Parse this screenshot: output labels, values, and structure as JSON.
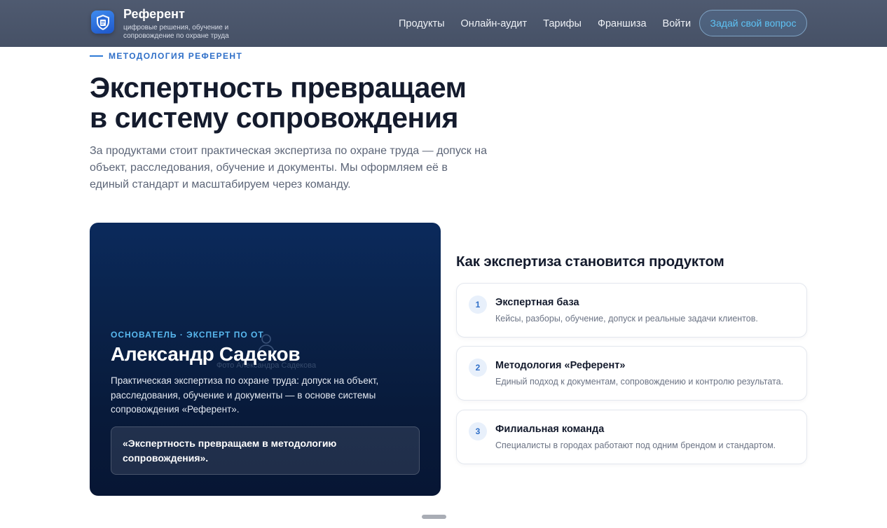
{
  "header": {
    "brand_name": "Референт",
    "brand_tagline": "цифровые решения, обучение и сопровождение по охране труда",
    "nav": [
      {
        "label": "Продукты"
      },
      {
        "label": "Онлайн-аудит"
      },
      {
        "label": "Тарифы"
      },
      {
        "label": "Франшиза"
      },
      {
        "label": "Войти"
      }
    ],
    "cta_label": "Задай свой вопрос",
    "logo_icon": "shield-document-icon"
  },
  "hero": {
    "kicker": "МЕТОДОЛОГИЯ РЕФЕРЕНТ",
    "title_line1": "Экспертность превращаем",
    "title_line2": "в систему сопровождения",
    "lead": "За продуктами стоит практическая экспертиза по охране труда — допуск на объект, расследования, обучение и документы. Мы оформляем её в единый стандарт и масштабируем через команду."
  },
  "founder": {
    "photo_placeholder": "Фото Александра Садекова",
    "role": "ОСНОВАТЕЛЬ · ЭКСПЕРТ ПО ОТ",
    "name": "Александр Садеков",
    "description": "Практическая экспертиза по охране труда: допуск на объект, расследования, обучение и документы — в основе системы сопровождения «Референт».",
    "quote": "«Экспертность превращаем в методологию сопровождения»."
  },
  "steps": {
    "title": "Как экспертиза становится продуктом",
    "items": [
      {
        "num": "1",
        "title": "Экспертная база",
        "desc": "Кейсы, разборы, обучение, допуск и реальные задачи клиентов."
      },
      {
        "num": "2",
        "title": "Методология «Референт»",
        "desc": "Единый подход к документам, сопровождению и контролю результата."
      },
      {
        "num": "3",
        "title": "Филиальная команда",
        "desc": "Специалисты в городах работают под одним брендом и стандартом."
      }
    ]
  },
  "colors": {
    "header_bg": "#4b566b",
    "accent": "#2f6fc8",
    "cta_text": "#5ec3f5",
    "card_bg": "#0a2249"
  }
}
